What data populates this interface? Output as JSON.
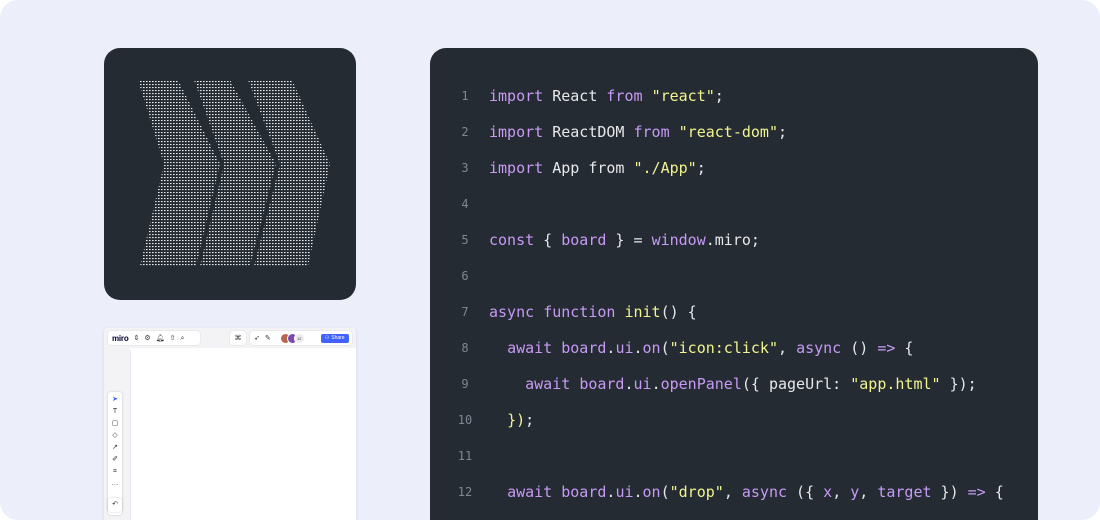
{
  "miro": {
    "brand": "miro",
    "share_label": "Share",
    "collaborator_count": "12"
  },
  "code": {
    "lines": [
      {
        "n": "1",
        "tokens": [
          [
            "kw",
            "import"
          ],
          [
            "pn",
            " React "
          ],
          [
            "kw",
            "from"
          ],
          [
            "pn",
            " "
          ],
          [
            "str",
            "\"react\""
          ],
          [
            "pn",
            ";"
          ]
        ]
      },
      {
        "n": "2",
        "tokens": [
          [
            "kw",
            "import"
          ],
          [
            "pn",
            " ReactDOM "
          ],
          [
            "kw",
            "from"
          ],
          [
            "pn",
            " "
          ],
          [
            "str",
            "\"react-dom\""
          ],
          [
            "pn",
            ";"
          ]
        ]
      },
      {
        "n": "3",
        "tokens": [
          [
            "kw",
            "import"
          ],
          [
            "pn",
            " App from "
          ],
          [
            "str",
            "\"./App\""
          ],
          [
            "pn",
            ";"
          ]
        ]
      },
      {
        "n": "4",
        "tokens": []
      },
      {
        "n": "5",
        "tokens": [
          [
            "kw",
            "const"
          ],
          [
            "pn",
            " { "
          ],
          [
            "kw",
            "board"
          ],
          [
            "pn",
            " } = "
          ],
          [
            "kw",
            "window"
          ],
          [
            "pn",
            ".miro;"
          ]
        ]
      },
      {
        "n": "6",
        "tokens": []
      },
      {
        "n": "7",
        "tokens": [
          [
            "kw",
            "async"
          ],
          [
            "pn",
            " "
          ],
          [
            "kw",
            "function"
          ],
          [
            "pn",
            " "
          ],
          [
            "str",
            "init"
          ],
          [
            "pn",
            "() {"
          ]
        ]
      },
      {
        "n": "8",
        "tokens": [
          [
            "pn",
            "  "
          ],
          [
            "kw",
            "await"
          ],
          [
            "pn",
            " "
          ],
          [
            "kw",
            "board"
          ],
          [
            "pn",
            "."
          ],
          [
            "kw",
            "ui"
          ],
          [
            "pn",
            "."
          ],
          [
            "kw",
            "on"
          ],
          [
            "pn",
            "("
          ],
          [
            "str",
            "\"icon:click\""
          ],
          [
            "pn",
            ", "
          ],
          [
            "kw",
            "async"
          ],
          [
            "pn",
            " () "
          ],
          [
            "kw",
            "=>"
          ],
          [
            "pn",
            " {"
          ]
        ]
      },
      {
        "n": "9",
        "tokens": [
          [
            "pn",
            "    "
          ],
          [
            "kw",
            "await"
          ],
          [
            "pn",
            " "
          ],
          [
            "kw",
            "board"
          ],
          [
            "pn",
            "."
          ],
          [
            "kw",
            "ui"
          ],
          [
            "pn",
            "."
          ],
          [
            "kw",
            "openPanel"
          ],
          [
            "pn",
            "({ pageUrl: "
          ],
          [
            "str",
            "\"app.html\""
          ],
          [
            "pn",
            " });"
          ]
        ]
      },
      {
        "n": "10",
        "tokens": [
          [
            "pn",
            "  "
          ],
          [
            "yl",
            "})"
          ],
          [
            "pn",
            ";"
          ]
        ]
      },
      {
        "n": "11",
        "tokens": []
      },
      {
        "n": "12",
        "tokens": [
          [
            "pn",
            "  "
          ],
          [
            "kw",
            "await"
          ],
          [
            "pn",
            " "
          ],
          [
            "kw",
            "board"
          ],
          [
            "pn",
            "."
          ],
          [
            "kw",
            "ui"
          ],
          [
            "pn",
            "."
          ],
          [
            "kw",
            "on"
          ],
          [
            "pn",
            "("
          ],
          [
            "str",
            "\"drop\""
          ],
          [
            "pn",
            ", "
          ],
          [
            "kw",
            "async"
          ],
          [
            "pn",
            " ({ "
          ],
          [
            "kw",
            "x"
          ],
          [
            "pn",
            ", "
          ],
          [
            "kw",
            "y"
          ],
          [
            "pn",
            ", "
          ],
          [
            "kw",
            "target"
          ],
          [
            "pn",
            " }) "
          ],
          [
            "kw",
            "=>"
          ],
          [
            "pn",
            " {"
          ]
        ]
      }
    ]
  }
}
